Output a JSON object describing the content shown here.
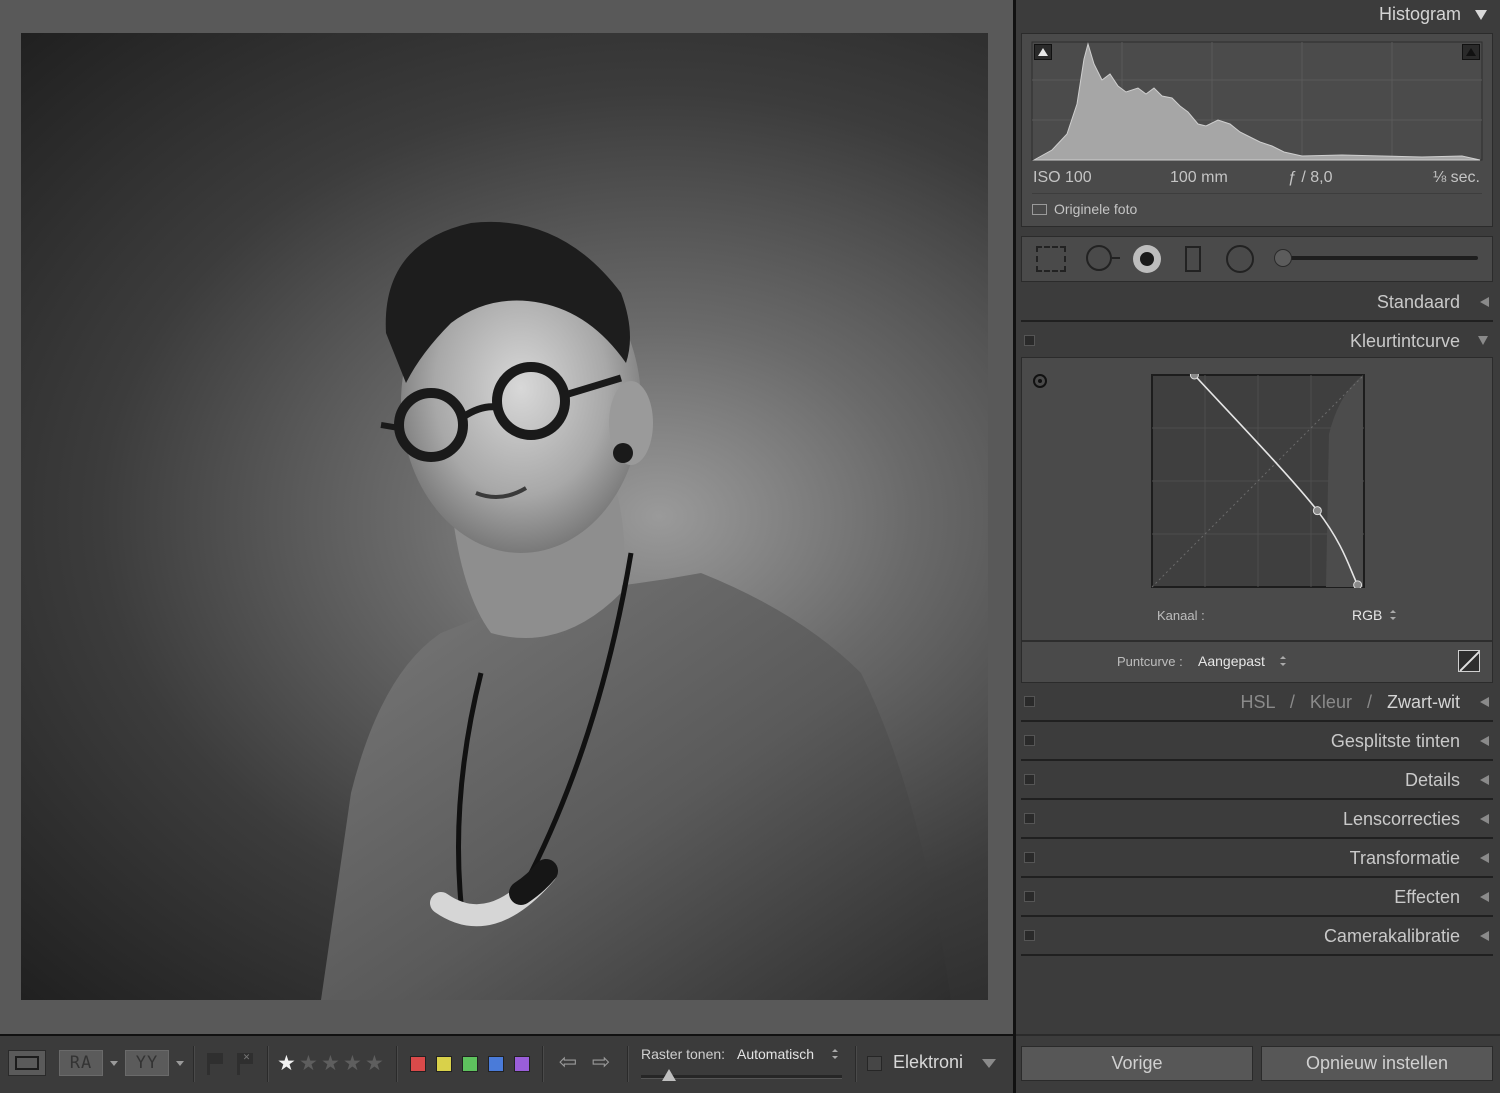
{
  "photo": {
    "alt": "Zwart-wit portret van een vrouw met ronde bril"
  },
  "toolbar": {
    "ra_label": "RA",
    "yy_label": "YY",
    "rating_stars": 1,
    "rating_max": 5,
    "color_labels": [
      "#d94a4a",
      "#d9d14a",
      "#5ec25e",
      "#4a7bd9",
      "#9a5ed9"
    ],
    "raster_label": "Raster tonen:",
    "raster_value": "Automatisch",
    "slider_value": 0.14,
    "dropdown_value": "Elektroni"
  },
  "histogram": {
    "title": "Histogram",
    "iso": "ISO 100",
    "focal": "100 mm",
    "aperture": "ƒ / 8,0",
    "shutter": "⅛ sec.",
    "original_label": "Originele foto"
  },
  "tools": {
    "slider_value": 0.0
  },
  "panels": {
    "standaard": "Standaard",
    "kleurtintcurve": "Kleurtintcurve",
    "hsl": "HSL",
    "sep": "/",
    "kleur": "Kleur",
    "zwartwit": "Zwart-wit",
    "gesplitste_tinten": "Gesplitste tinten",
    "details": "Details",
    "lenscorrecties": "Lenscorrecties",
    "transformatie": "Transformatie",
    "effecten": "Effecten",
    "camerakalibratie": "Camerakalibratie"
  },
  "curve": {
    "kanaal_label": "Kanaal :",
    "kanaal_value": "RGB",
    "puntcurve_label": "Puntcurve :",
    "puntcurve_value": "Aangepast",
    "points": [
      [
        0.2,
        1.0
      ],
      [
        0.78,
        0.36
      ],
      [
        0.97,
        0.01
      ]
    ]
  },
  "buttons": {
    "vorige": "Vorige",
    "opnieuw": "Opnieuw instellen"
  }
}
